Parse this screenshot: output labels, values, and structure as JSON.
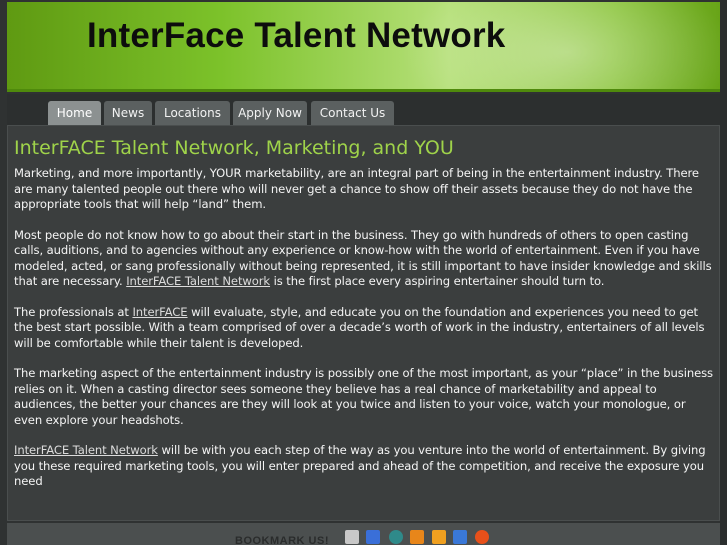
{
  "header": {
    "title": "InterFace Talent Network"
  },
  "nav": {
    "tabs": [
      {
        "label": "Home",
        "active": true
      },
      {
        "label": "News",
        "active": false
      },
      {
        "label": "Locations",
        "active": false
      },
      {
        "label": "Apply Now",
        "active": false
      },
      {
        "label": "Contact Us",
        "active": false
      }
    ]
  },
  "main": {
    "heading": "InterFACE Talent Network, Marketing, and YOU",
    "p1": "Marketing, and more importantly, YOUR marketability, are an integral part of being in the entertainment industry. There are many talented people out there who will never get a chance to show off their assets because they do not have the appropriate tools that will help “land” them.",
    "p2_pre": "Most people do not know how to go about their start in the business. They go with hundreds of others to open casting calls, auditions, and to agencies without any experience or know-how with the world of entertainment. Even if you have modeled, acted, or sang professionally without being represented, it is still important to have insider knowledge and skills that are necessary. ",
    "p2_link": "InterFACE Talent Network",
    "p2_post": " is the first place every aspiring entertainer should turn to.",
    "p3_pre": "The professionals at ",
    "p3_link": "InterFACE",
    "p3_post": " will evaluate, style, and educate you on the foundation and experiences you need to get the best start possible. With a team comprised of over a decade’s worth of work in the industry, entertainers of all levels will be comfortable while their talent is developed.",
    "p4": "The marketing aspect of the entertainment industry is possibly one of the most important, as your “place” in the business relies on it. When a casting director sees someone they believe has a real chance of marketability and appeal to audiences, the better your chances are they will look at you twice and listen to your voice, watch your monologue, or even explore your headshots.",
    "p5_link": "InterFACE Talent Network",
    "p5_post": " will be with you each step of the way as you venture into the world of entertainment. By giving you these required marketing tools, you will enter prepared and ahead of the competition, and receive the exposure you need"
  },
  "footer": {
    "bookmark_label": "BOOKMARK US!",
    "bookmark_icons": [
      {
        "name": "digg-icon",
        "color": "#c8c8c8"
      },
      {
        "name": "delicious-icon",
        "color": "#3a6fd8"
      },
      {
        "name": "newsvine-icon",
        "color": "#2f8a8a"
      },
      {
        "name": "furl-icon",
        "color": "#e8861a"
      },
      {
        "name": "reddit-icon",
        "color": "#f0a020"
      },
      {
        "name": "google-icon",
        "color": "#3a78d8"
      },
      {
        "name": "stumbleupon-icon",
        "color": "#e8501a"
      }
    ]
  }
}
